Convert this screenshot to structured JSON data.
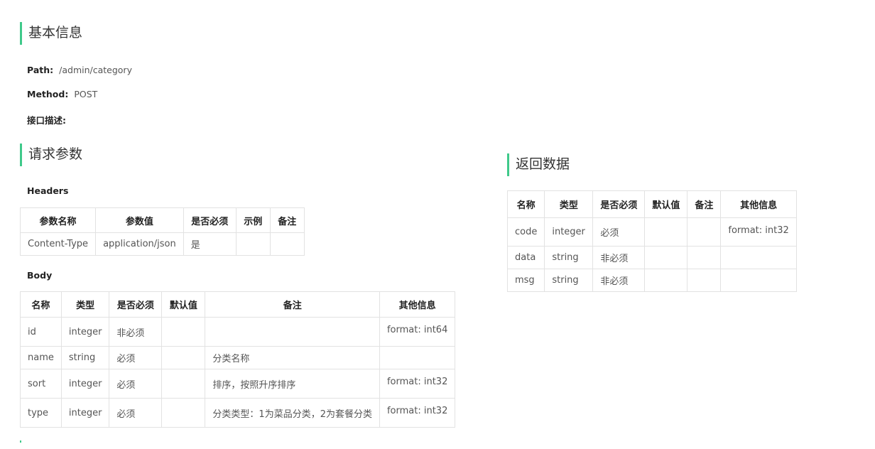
{
  "basic": {
    "title": "基本信息",
    "path_label": "Path:",
    "path_value": "/admin/category",
    "method_label": "Method:",
    "method_value": "POST",
    "desc_label": "接口描述:"
  },
  "request": {
    "title": "请求参数",
    "headers_title": "Headers",
    "headers_columns": [
      "参数名称",
      "参数值",
      "是否必须",
      "示例",
      "备注"
    ],
    "headers_rows": [
      [
        "Content-Type",
        "application/json",
        "是",
        "",
        ""
      ]
    ],
    "body_title": "Body",
    "body_columns": [
      "名称",
      "类型",
      "是否必须",
      "默认值",
      "备注",
      "其他信息"
    ],
    "body_rows": [
      [
        "id",
        "integer",
        "非必须",
        "",
        "",
        "format: int64"
      ],
      [
        "name",
        "string",
        "必须",
        "",
        "分类名称",
        ""
      ],
      [
        "sort",
        "integer",
        "必须",
        "",
        "排序，按照升序排序",
        "format: int32"
      ],
      [
        "type",
        "integer",
        "必须",
        "",
        "分类类型：1为菜品分类，2为套餐分类",
        "format: int32"
      ]
    ]
  },
  "response": {
    "title": "返回数据",
    "columns": [
      "名称",
      "类型",
      "是否必须",
      "默认值",
      "备注",
      "其他信息"
    ],
    "rows": [
      [
        "code",
        "integer",
        "必须",
        "",
        "",
        "format: int32"
      ],
      [
        "data",
        "string",
        "非必须",
        "",
        "",
        ""
      ],
      [
        "msg",
        "string",
        "非必须",
        "",
        "",
        ""
      ]
    ]
  },
  "colors": {
    "accent": "#3fc98a",
    "border": "#e2e2e2"
  }
}
